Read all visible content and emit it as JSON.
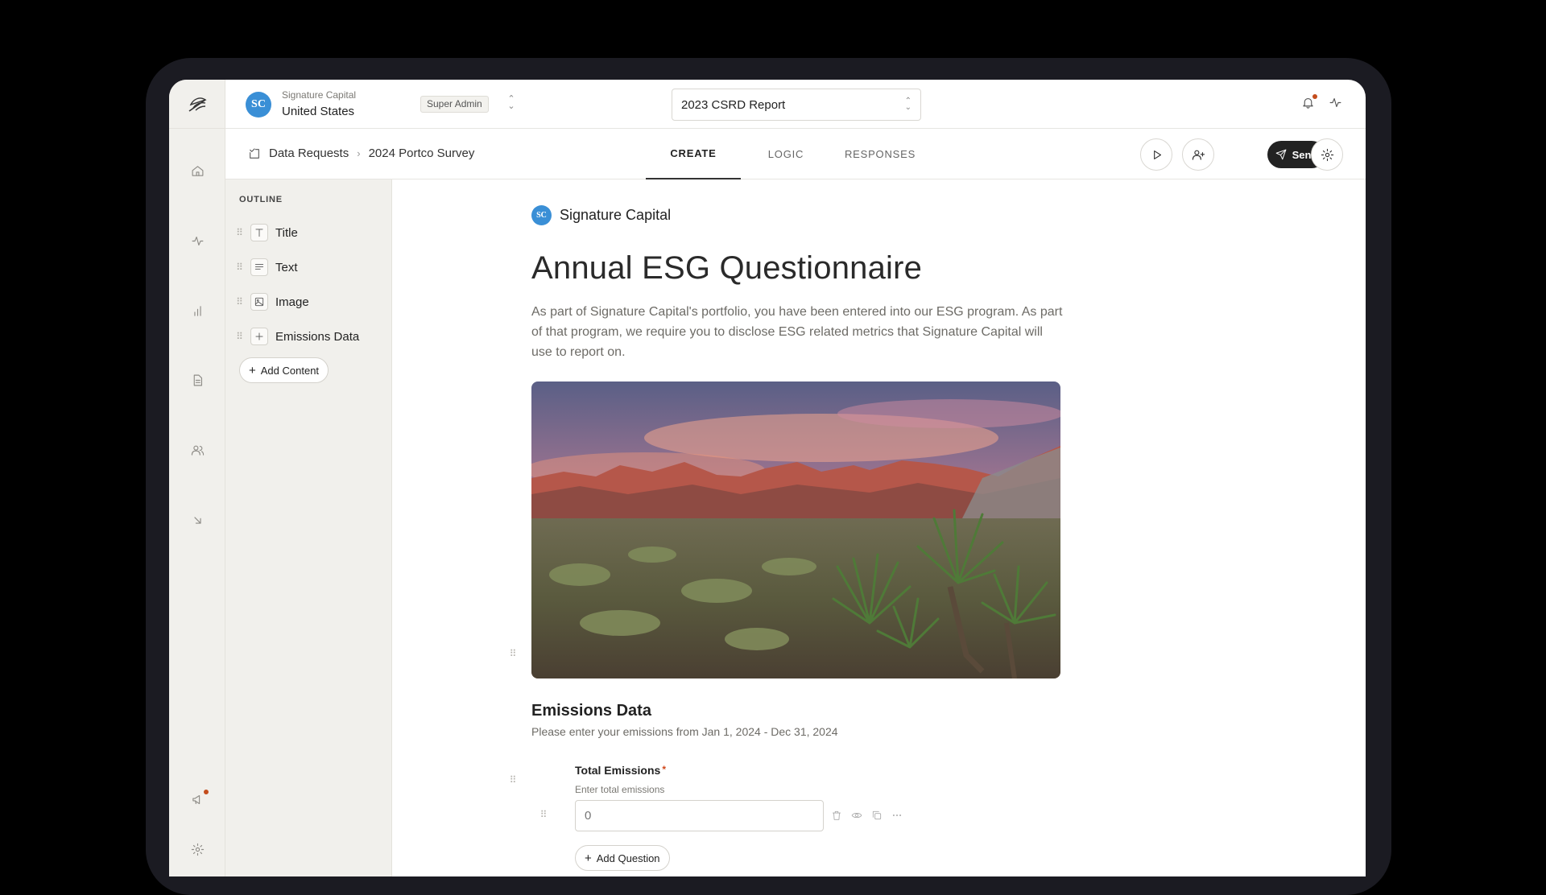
{
  "org": {
    "avatar_initials": "SC",
    "name": "Signature Capital",
    "country": "United States",
    "role": "Super Admin"
  },
  "report_select": {
    "value": "2023 CSRD Report"
  },
  "breadcrumb": {
    "root": "Data Requests",
    "current": "2024 Portco Survey"
  },
  "tabs": [
    {
      "label": "CREATE",
      "active": true
    },
    {
      "label": "LOGIC",
      "active": false
    },
    {
      "label": "RESPONSES",
      "active": false
    }
  ],
  "actions": {
    "send_label": "Send"
  },
  "outline": {
    "title": "OUTLINE",
    "items": [
      {
        "label": "Title",
        "icon": "text-type-icon"
      },
      {
        "label": "Text",
        "icon": "paragraph-icon"
      },
      {
        "label": "Image",
        "icon": "image-icon"
      },
      {
        "label": "Emissions Data",
        "icon": "plus-icon"
      }
    ],
    "add_label": "Add Content"
  },
  "survey": {
    "brand_initials": "SC",
    "brand_name": "Signature Capital",
    "title": "Annual ESG Questionnaire",
    "description": "As part of Signature Capital's portfolio, you have been entered into our ESG program. As part of that program, we require you to disclose ESG related metrics that Signature Capital will use to report on.",
    "section": {
      "title": "Emissions Data",
      "description": "Please enter your emissions from Jan 1, 2024 - Dec 31, 2024",
      "question": {
        "label": "Total Emissions",
        "required_mark": "*",
        "hint": "Enter total emissions",
        "placeholder": "0"
      },
      "add_question_label": "Add Question"
    }
  },
  "colors": {
    "accent": "#3a8fd6",
    "dark": "#222222",
    "notification": "#c44d1d",
    "sidebar_bg": "#f1f0ec"
  }
}
